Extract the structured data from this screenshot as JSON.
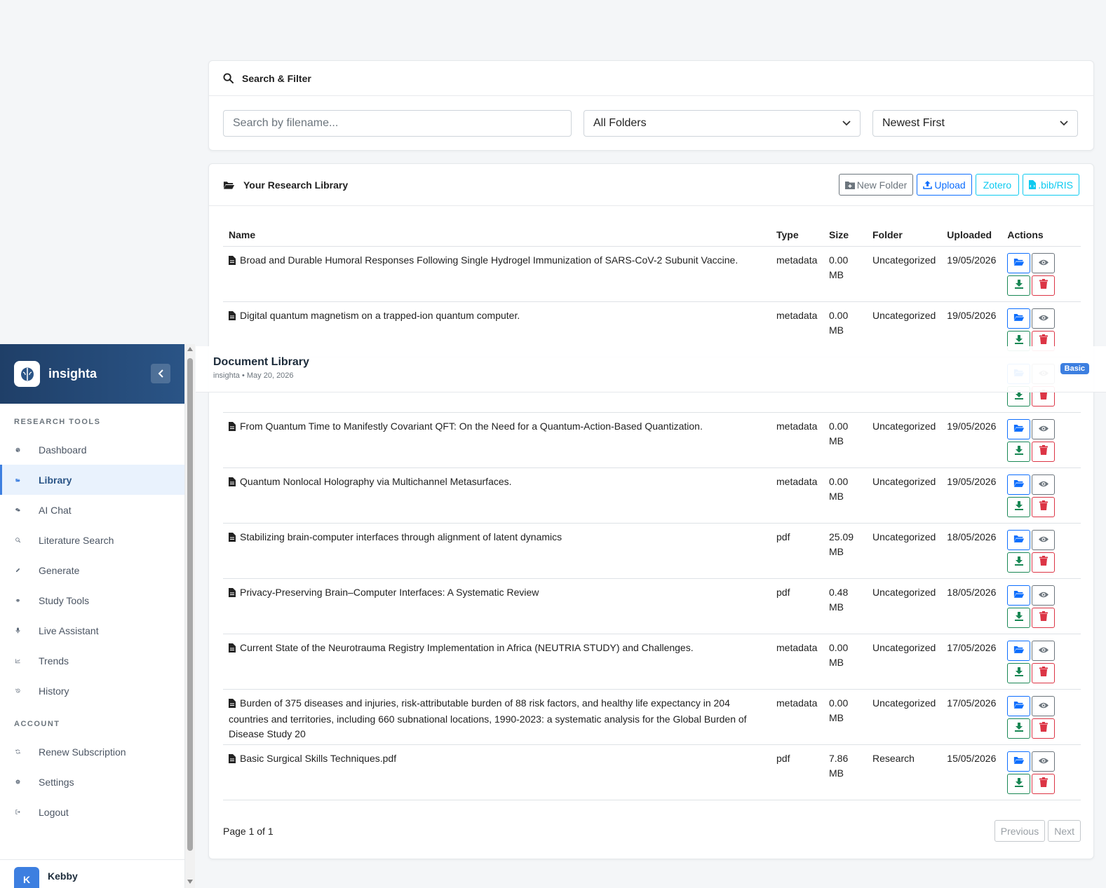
{
  "search": {
    "title": "Search & Filter",
    "placeholder": "Search by filename...",
    "folder_select": "All Folders",
    "sort_select": "Newest First"
  },
  "library": {
    "title": "Your Research Library",
    "buttons": {
      "new_folder": "New Folder",
      "upload": "Upload",
      "zotero": "Zotero",
      "bib": ".bib/RIS"
    },
    "columns": [
      "Name",
      "Type",
      "Size",
      "Folder",
      "Uploaded",
      "Actions"
    ],
    "rows": [
      {
        "name": "Broad and Durable Humoral Responses Following Single Hydrogel Immunization of SARS-CoV-2 Subunit Vaccine.",
        "type": "metadata",
        "size_num": "0.00",
        "size_unit": "MB",
        "folder": "Uncategorized",
        "date": "19/05/2026"
      },
      {
        "name": "Digital quantum magnetism on a trapped-ion quantum computer.",
        "type": "metadata",
        "size_num": "0.00",
        "size_unit": "MB",
        "folder": "Uncategorized",
        "date": "19/05/2026"
      },
      {
        "name": "",
        "type": "",
        "size_num": "",
        "size_unit": "",
        "folder": "",
        "date": ""
      },
      {
        "name": "From Quantum Time to Manifestly Covariant QFT: On the Need for a Quantum-Action-Based Quantization.",
        "type": "metadata",
        "size_num": "0.00",
        "size_unit": "MB",
        "folder": "Uncategorized",
        "date": "19/05/2026"
      },
      {
        "name": "Quantum Nonlocal Holography via Multichannel Metasurfaces.",
        "type": "metadata",
        "size_num": "0.00",
        "size_unit": "MB",
        "folder": "Uncategorized",
        "date": "19/05/2026"
      },
      {
        "name": "Stabilizing brain-computer interfaces through alignment of latent dynamics",
        "type": "pdf",
        "size_num": "25.09",
        "size_unit": "MB",
        "folder": "Uncategorized",
        "date": "18/05/2026"
      },
      {
        "name": "Privacy-Preserving Brain–Computer Interfaces: A Systematic Review",
        "type": "pdf",
        "size_num": "0.48",
        "size_unit": "MB",
        "folder": "Uncategorized",
        "date": "18/05/2026"
      },
      {
        "name": "Current State of the Neurotrauma Registry Implementation in Africa (NEUTRIA STUDY) and Challenges.",
        "type": "metadata",
        "size_num": "0.00",
        "size_unit": "MB",
        "folder": "Uncategorized",
        "date": "17/05/2026"
      },
      {
        "name": "Burden of 375 diseases and injuries, risk-attributable burden of 88 risk factors, and healthy life expectancy in 204 countries and territories, including 660 subnational locations, 1990-2023: a systematic analysis for the Global Burden of Disease Study 20",
        "type": "metadata",
        "size_num": "0.00",
        "size_unit": "MB",
        "folder": "Uncategorized",
        "date": "17/05/2026"
      },
      {
        "name": "Basic Surgical Skills Techniques.pdf",
        "type": "pdf",
        "size_num": "7.86",
        "size_unit": "MB",
        "folder": "Research",
        "date": "15/05/2026"
      }
    ],
    "pager": {
      "text": "Page 1 of 1",
      "prev": "Previous",
      "next": "Next"
    }
  },
  "header": {
    "title": "Document Library",
    "subtitle": "insighta • May 20, 2026",
    "badge": "Basic"
  },
  "sidebar": {
    "brand": "insighta",
    "section_tools": "RESEARCH TOOLS",
    "tools": [
      {
        "label": "Dashboard",
        "icon": "palette-icon"
      },
      {
        "label": "Library",
        "icon": "folder-open-icon",
        "active": true
      },
      {
        "label": "AI Chat",
        "icon": "comments-icon"
      },
      {
        "label": "Literature Search",
        "icon": "search-icon"
      },
      {
        "label": "Generate",
        "icon": "pen-icon"
      },
      {
        "label": "Study Tools",
        "icon": "graduation-cap-icon"
      },
      {
        "label": "Live Assistant",
        "icon": "microphone-icon"
      },
      {
        "label": "Trends",
        "icon": "chart-line-icon"
      },
      {
        "label": "History",
        "icon": "history-icon"
      }
    ],
    "section_account": "ACCOUNT",
    "account": [
      {
        "label": "Renew Subscription",
        "icon": "sync-icon"
      },
      {
        "label": "Settings",
        "icon": "gear-icon"
      },
      {
        "label": "Logout",
        "icon": "logout-icon"
      }
    ],
    "user": {
      "initial": "K",
      "name": "Kebby"
    }
  },
  "colors": {
    "primary": "#0d6efd",
    "success": "#198754",
    "danger": "#dc3545",
    "info": "#0dcaf0",
    "brand": "#1f3f68",
    "badge": "#3d7fe0"
  }
}
